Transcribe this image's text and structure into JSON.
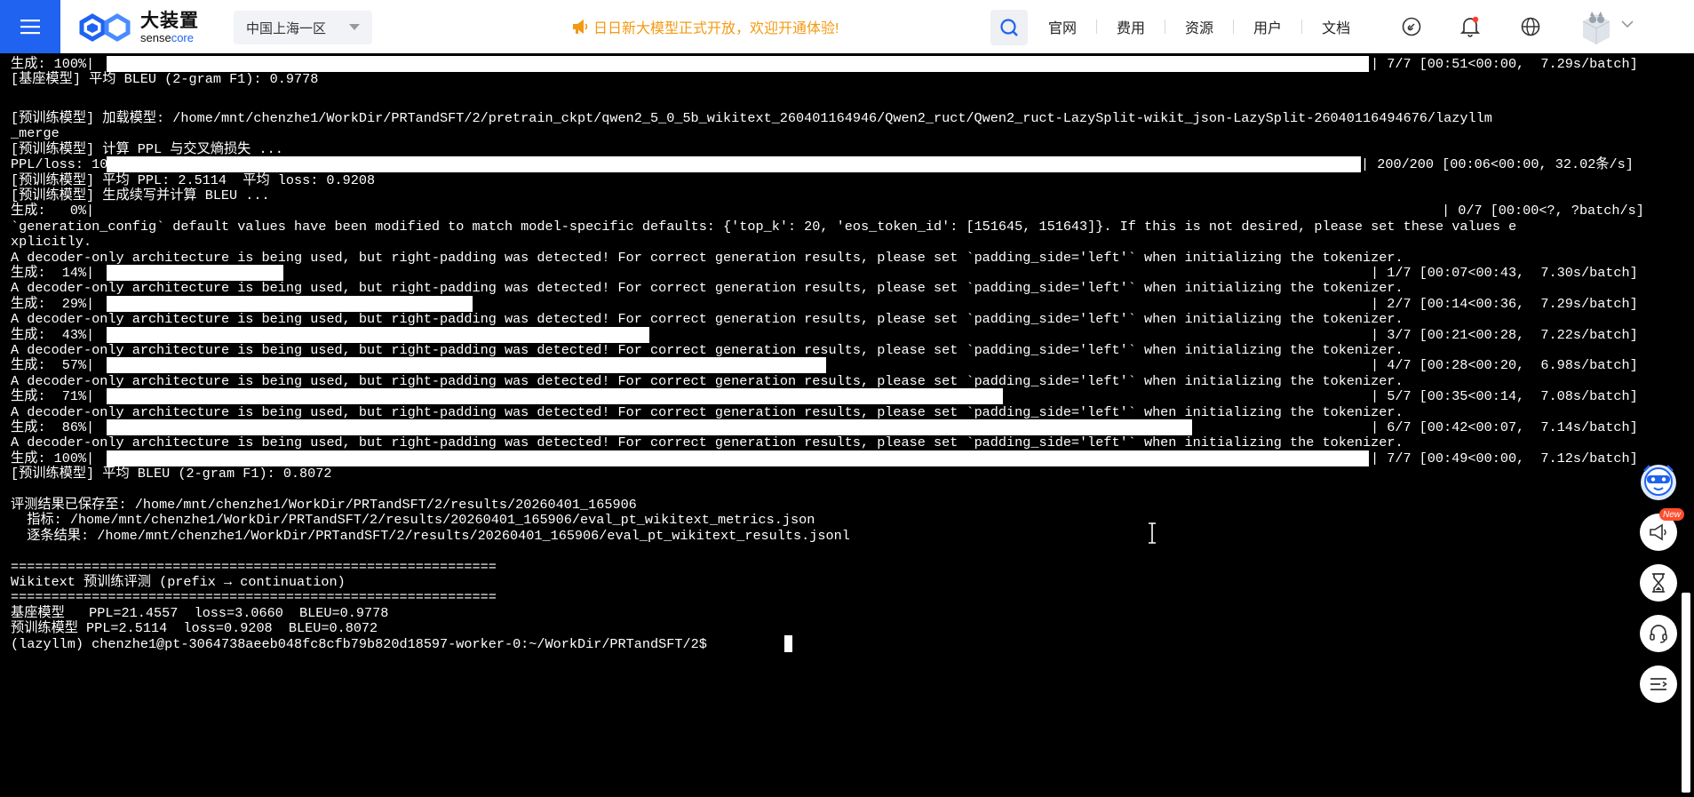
{
  "nav": {
    "logo_cn": "大装置",
    "logo_en_a": "sense",
    "logo_en_b": "core",
    "region": "中国上海一区",
    "announcement": "日日新大模型正式开放，欢迎开通体验!",
    "links": [
      "官网",
      "费用",
      "资源",
      "用户",
      "文档"
    ],
    "icons": [
      "menu-icon",
      "search-icon",
      "link-icon",
      "bell-icon",
      "globe-icon",
      "avatar-icon"
    ]
  },
  "terminal": {
    "lines": [
      "生成: 100%|",
      "[基座模型] 平均 BLEU (2-gram F1): 0.9778",
      "",
      "[预训练模型] 加载模型: /home/mnt/chenzhe1/WorkDir/PRTandSFT/2/pretrain_ckpt/qwen2_5_0_5b_wikitext_260401164946/Qwen2_ruct/Qwen2_ruct-LazySplit-wikit_json-LazySplit-26040116494676/lazyllm",
      "_merge",
      "[预训练模型] 计算 PPL 与交叉熵损失 ...",
      "PPL/loss: 100%|",
      "[预训练模型] 平均 PPL: 2.5114  平均 loss: 0.9208",
      "[预训练模型] 生成续写并计算 BLEU ...",
      "生成:   0%|",
      "`generation_config` default values have been modified to match model-specific defaults: {'top_k': 20, 'eos_token_id': [151645, 151643]}. If this is not desired, please set these values e",
      "xplicitly.",
      "A decoder-only architecture is being used, but right-padding was detected! For correct generation results, please set `padding_side='left'` when initializing the tokenizer.",
      "生成:  14%|",
      "A decoder-only architecture is being used, but right-padding was detected! For correct generation results, please set `padding_side='left'` when initializing the tokenizer.",
      "生成:  29%|",
      "A decoder-only architecture is being used, but right-padding was detected! For correct generation results, please set `padding_side='left'` when initializing the tokenizer.",
      "生成:  43%|",
      "A decoder-only architecture is being used, but right-padding was detected! For correct generation results, please set `padding_side='left'` when initializing the tokenizer.",
      "生成:  57%|",
      "A decoder-only architecture is being used, but right-padding was detected! For correct generation results, please set `padding_side='left'` when initializing the tokenizer.",
      "生成:  71%|",
      "A decoder-only architecture is being used, but right-padding was detected! For correct generation results, please set `padding_side='left'` when initializing the tokenizer.",
      "生成:  86%|",
      "A decoder-only architecture is being used, but right-padding was detected! For correct generation results, please set `padding_side='left'` when initializing the tokenizer.",
      "生成: 100%|",
      "[预训练模型] 平均 BLEU (2-gram F1): 0.8072",
      "",
      "评测结果已保存至: /home/mnt/chenzhe1/WorkDir/PRTandSFT/2/results/20260401_165906",
      "  指标: /home/mnt/chenzhe1/WorkDir/PRTandSFT/2/results/20260401_165906/eval_pt_wikitext_metrics.json",
      "  逐条结果: /home/mnt/chenzhe1/WorkDir/PRTandSFT/2/results/20260401_165906/eval_pt_wikitext_results.jsonl",
      "",
      "============================================================",
      "Wikitext 预训练评测 (prefix → continuation)",
      "============================================================",
      "基座模型   PPL=21.4557  loss=3.0660  BLEU=0.9778",
      "预训练模型 PPL=2.5114  loss=0.9208  BLEU=0.8072",
      "(lazyllm) chenzhe1@pt-3064738aeeb048fc8cfb79b820d18597-worker-0:~/WorkDir/PRTandSFT/2$ "
    ],
    "progress": [
      {
        "line": 0,
        "fraction": 1.0,
        "stats": "| 7/7 [00:51<00:00,  7.29s/batch]"
      },
      {
        "line": 6,
        "fraction": 1.0,
        "stats": "| 200/200 [00:06<00:00, 32.02条/s]"
      },
      {
        "line": 9,
        "fraction": 0.0,
        "stats": "| 0/7 [00:00<?, ?batch/s]"
      },
      {
        "line": 13,
        "fraction": 0.14,
        "stats": "| 1/7 [00:07<00:43,  7.30s/batch]"
      },
      {
        "line": 15,
        "fraction": 0.29,
        "stats": "| 2/7 [00:14<00:36,  7.29s/batch]"
      },
      {
        "line": 17,
        "fraction": 0.43,
        "stats": "| 3/7 [00:21<00:28,  7.22s/batch]"
      },
      {
        "line": 19,
        "fraction": 0.57,
        "stats": "| 4/7 [00:28<00:20,  6.98s/batch]"
      },
      {
        "line": 21,
        "fraction": 0.71,
        "stats": "| 5/7 [00:35<00:14,  7.08s/batch]"
      },
      {
        "line": 23,
        "fraction": 0.86,
        "stats": "| 6/7 [00:42<00:07,  7.14s/batch]"
      },
      {
        "line": 25,
        "fraction": 1.0,
        "stats": "| 7/7 [00:49<00:00,  7.12s/batch]"
      }
    ]
  },
  "floating": {
    "new_badge": "New",
    "icons": [
      "mascot-icon",
      "megaphone-icon",
      "hourglass-icon",
      "headset-icon",
      "collapse-menu-icon"
    ]
  },
  "colors": {
    "brand": "#1f63f0",
    "announce": "#f39a12",
    "terminal_bg": "#000000",
    "terminal_fg": "#ffffff"
  }
}
